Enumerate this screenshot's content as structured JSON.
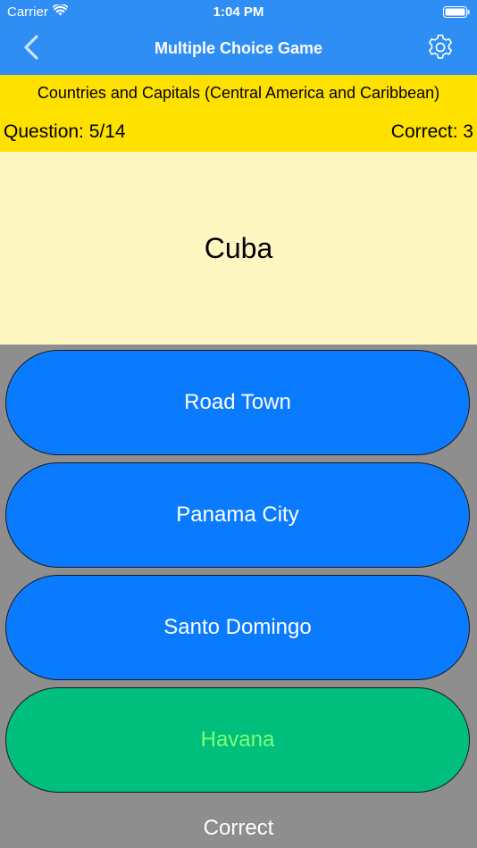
{
  "status_bar": {
    "carrier": "Carrier",
    "time": "1:04 PM"
  },
  "nav": {
    "title": "Multiple Choice Game",
    "back_icon": "chevron-left-icon",
    "settings_icon": "gear-icon"
  },
  "game": {
    "category": "Countries and Capitals (Central America and Caribbean)",
    "question_label": "Question: 5/14",
    "correct_label": "Correct: 3",
    "question": "Cuba",
    "answers": [
      "Road Town",
      "Panama City",
      "Santo Domingo",
      "Havana"
    ],
    "feedback": "Correct"
  },
  "colors": {
    "nav_blue": "#2f8ef4",
    "info_yellow": "#ffe100",
    "question_bg": "#fff7c2",
    "answer_blue": "#0a7bff",
    "answer_correct_green": "#00bf7d",
    "background_gray": "#8e8e8e"
  }
}
